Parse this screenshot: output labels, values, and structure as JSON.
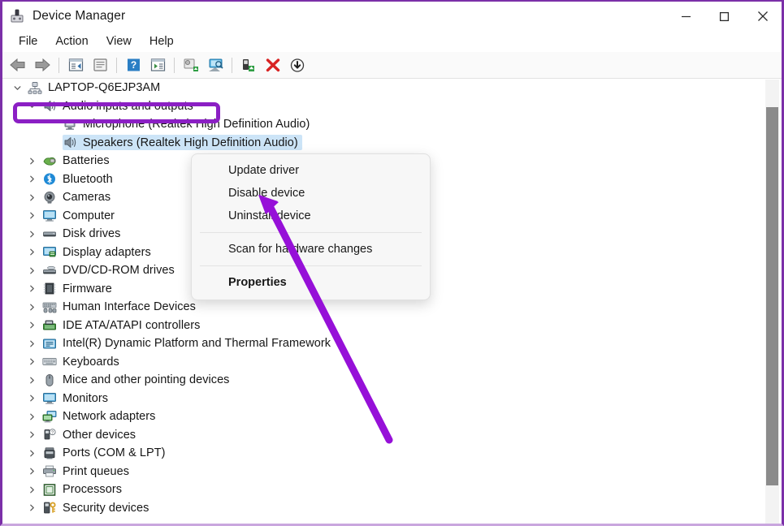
{
  "window": {
    "title": "Device Manager",
    "app_icon": "device-manager-icon",
    "controls": {
      "minimize": "—",
      "maximize": "□",
      "close": "✕"
    }
  },
  "menubar": {
    "items": [
      {
        "label": "File"
      },
      {
        "label": "Action"
      },
      {
        "label": "View"
      },
      {
        "label": "Help"
      }
    ]
  },
  "toolbar": {
    "buttons": [
      {
        "name": "back-icon",
        "tip": "Back"
      },
      {
        "name": "forward-icon",
        "tip": "Forward"
      },
      {
        "name": "properties-icon",
        "tip": "Properties"
      },
      {
        "name": "show-hidden-icon",
        "tip": "Show hidden devices"
      },
      {
        "name": "help-icon",
        "tip": "Help"
      },
      {
        "name": "details-icon",
        "tip": "Details"
      },
      {
        "name": "update-driver-icon",
        "tip": "Update driver"
      },
      {
        "name": "scan-hardware-icon",
        "tip": "Scan for hardware changes"
      },
      {
        "name": "enable-device-icon",
        "tip": "Enable device"
      },
      {
        "name": "uninstall-device-icon",
        "tip": "Uninstall device"
      },
      {
        "name": "disable-device-icon",
        "tip": "Disable device"
      }
    ]
  },
  "tree": {
    "root": {
      "label": "LAPTOP-Q6EJP3AM",
      "icon": "computer-node-icon",
      "expanded": true
    },
    "audio_group": {
      "label": "Audio inputs and outputs",
      "icon": "speaker-icon",
      "expanded": true,
      "highlighted": true
    },
    "audio_children": [
      {
        "label": "Microphone (Realtek High Definition Audio)",
        "icon": "microphone-icon",
        "selected": false
      },
      {
        "label": "Speakers (Realtek High Definition Audio)",
        "icon": "speaker-icon",
        "selected": true
      }
    ],
    "categories": [
      {
        "label": "Batteries",
        "icon": "battery-icon"
      },
      {
        "label": "Bluetooth",
        "icon": "bluetooth-icon"
      },
      {
        "label": "Cameras",
        "icon": "camera-icon"
      },
      {
        "label": "Computer",
        "icon": "monitor-icon"
      },
      {
        "label": "Disk drives",
        "icon": "disk-drive-icon"
      },
      {
        "label": "Display adapters",
        "icon": "display-adapter-icon"
      },
      {
        "label": "DVD/CD-ROM drives",
        "icon": "optical-drive-icon"
      },
      {
        "label": "Firmware",
        "icon": "chip-icon"
      },
      {
        "label": "Human Interface Devices",
        "icon": "hid-icon"
      },
      {
        "label": "IDE ATA/ATAPI controllers",
        "icon": "ide-controller-icon"
      },
      {
        "label": "Intel(R) Dynamic Platform and Thermal Framework",
        "icon": "intel-platform-icon"
      },
      {
        "label": "Keyboards",
        "icon": "keyboard-icon"
      },
      {
        "label": "Mice and other pointing devices",
        "icon": "mouse-icon"
      },
      {
        "label": "Monitors",
        "icon": "monitor-icon"
      },
      {
        "label": "Network adapters",
        "icon": "network-adapter-icon"
      },
      {
        "label": "Other devices",
        "icon": "unknown-device-icon"
      },
      {
        "label": "Ports (COM & LPT)",
        "icon": "port-icon"
      },
      {
        "label": "Print queues",
        "icon": "printer-icon"
      },
      {
        "label": "Processors",
        "icon": "processor-icon"
      },
      {
        "label": "Security devices",
        "icon": "security-device-icon"
      }
    ]
  },
  "context_menu": {
    "items": [
      {
        "label": "Update driver",
        "bold": false
      },
      {
        "label": "Disable device",
        "bold": false
      },
      {
        "label": "Uninstall device",
        "bold": false
      },
      {
        "separator_after": true
      },
      {
        "label": "Scan for hardware changes",
        "bold": false
      },
      {
        "separator_after": true
      },
      {
        "label": "Properties",
        "bold": true
      }
    ]
  },
  "annotations": {
    "highlight_color": "#8b1fc4",
    "arrow_color": "#9610d8",
    "selection_color": "#cce4f7"
  }
}
